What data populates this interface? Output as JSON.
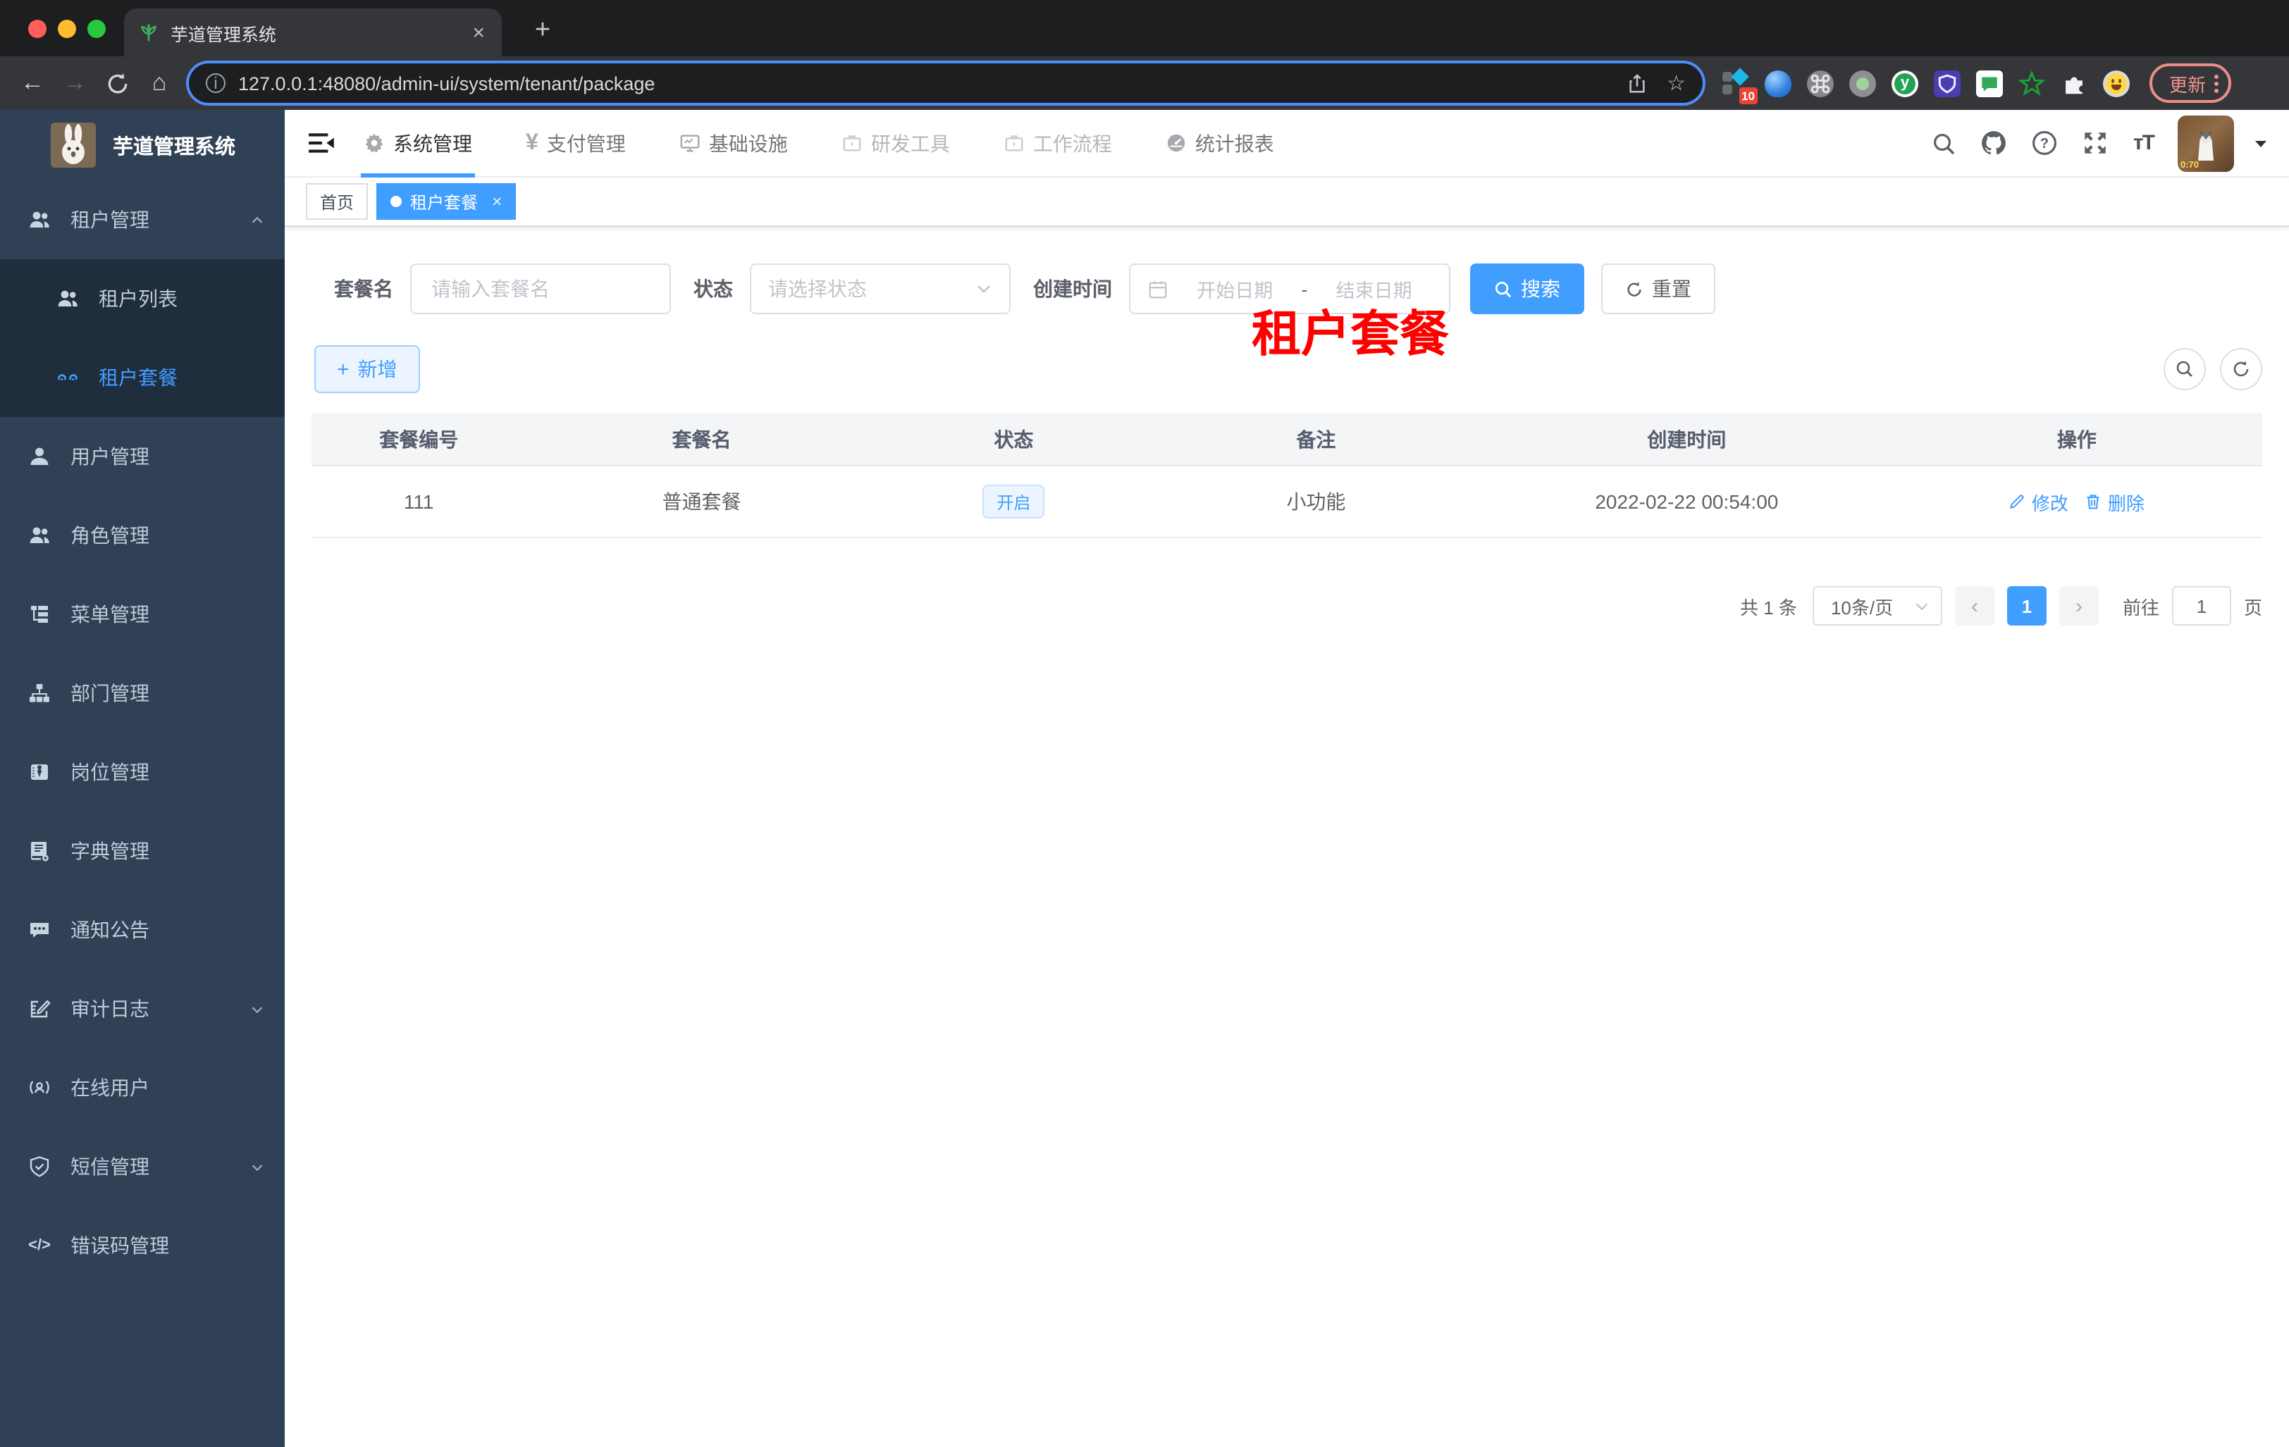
{
  "browser": {
    "tab": {
      "title": "芋道管理系统",
      "close": "×",
      "new_tab": "+"
    },
    "back": "←",
    "forward": "→",
    "home": "⌂",
    "url": "127.0.0.1:48080/admin-ui/system/tenant/package",
    "info_glyph": "i",
    "star": "☆",
    "extension_badge": "10",
    "update_button": "更新"
  },
  "sidebar": {
    "logo_title": "芋道管理系统",
    "items": [
      {
        "label": "租户管理",
        "icon": "peoples-icon"
      },
      {
        "label": "租户列表",
        "icon": "peoples-icon"
      },
      {
        "label": "租户套餐",
        "icon": "tenant-package-icon",
        "active": true
      },
      {
        "label": "用户管理",
        "icon": "user-icon"
      },
      {
        "label": "角色管理",
        "icon": "peoples-icon"
      },
      {
        "label": "菜单管理",
        "icon": "tree-table-icon"
      },
      {
        "label": "部门管理",
        "icon": "org-tree-icon"
      },
      {
        "label": "岗位管理",
        "icon": "post-icon"
      },
      {
        "label": "字典管理",
        "icon": "dict-icon"
      },
      {
        "label": "通知公告",
        "icon": "message-icon"
      },
      {
        "label": "审计日志",
        "icon": "log-icon"
      },
      {
        "label": "在线用户",
        "icon": "online-user-icon"
      },
      {
        "label": "短信管理",
        "icon": "sms-shield-icon"
      },
      {
        "label": "错误码管理",
        "icon": "code-icon",
        "icon_glyph": "</>"
      }
    ]
  },
  "header": {
    "nav": [
      {
        "label": "系统管理",
        "icon": "gear-icon",
        "state": "active"
      },
      {
        "label": "支付管理",
        "icon": "yen-icon",
        "glyph": "¥",
        "state": "normal"
      },
      {
        "label": "基础设施",
        "icon": "monitor-icon",
        "state": "normal"
      },
      {
        "label": "研发工具",
        "icon": "briefcase-icon",
        "state": "muted"
      },
      {
        "label": "工作流程",
        "icon": "briefcase-icon",
        "state": "muted"
      },
      {
        "label": "统计报表",
        "icon": "dashboard-icon",
        "state": "normal"
      }
    ],
    "font_size_icon": "тT",
    "avatar_timer": "0:70"
  },
  "tags": {
    "home": "首页",
    "active": "租户套餐",
    "close": "×"
  },
  "page": {
    "watermark": "租户套餐",
    "search": {
      "name_label": "套餐名",
      "name_placeholder": "请输入套餐名",
      "status_label": "状态",
      "status_placeholder": "请选择状态",
      "date_label": "创建时间",
      "date_start": "开始日期",
      "date_sep": "-",
      "date_end": "结束日期",
      "search_button": "搜索",
      "reset_button": "重置"
    },
    "add_button": "新增",
    "table": {
      "headers": [
        "套餐编号",
        "套餐名",
        "状态",
        "备注",
        "创建时间",
        "操作"
      ],
      "row": {
        "id": "111",
        "name": "普通套餐",
        "status": "开启",
        "remark": "小功能",
        "created": "2022-02-22 00:54:00",
        "edit": "修改",
        "delete": "删除"
      }
    },
    "pagination": {
      "total": "共 1 条",
      "size": "10条/页",
      "prev": "‹",
      "page": "1",
      "next": "›",
      "goto": "前往",
      "goto_value": "1",
      "unit": "页"
    }
  },
  "colors": {
    "accent": "#409eff",
    "sidebar_bg": "#304156",
    "submenu_bg": "#1f2d3d",
    "watermark_red": "#ff0000",
    "status_tag_bg": "#ecf5ff",
    "status_tag_border": "#c6e2ff",
    "tab_active_bg": "#409eff",
    "update_pill": "#f1948c"
  }
}
